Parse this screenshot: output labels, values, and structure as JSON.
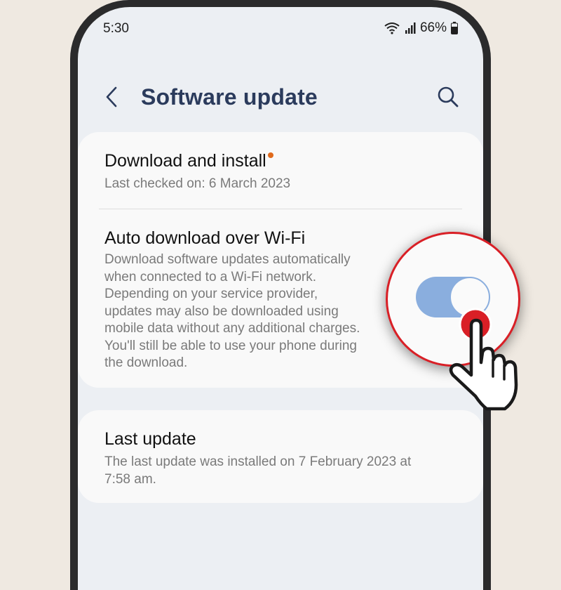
{
  "status_bar": {
    "time": "5:30",
    "battery": "66%"
  },
  "header": {
    "title": "Software update",
    "icons": {
      "back": "back-arrow-icon",
      "search": "search-icon"
    }
  },
  "items": [
    {
      "title": "Download and install",
      "subtitle": "Last checked on: 6 March 2023",
      "badge": "new-dot"
    },
    {
      "title": "Auto download over Wi-Fi",
      "description_lines": [
        "Download software updates automatically",
        "when connected to a Wi-Fi network.",
        "Depending on your service provider,",
        "updates may also be downloaded using",
        "mobile data without any additional charges.",
        "You'll still be able to use your phone during",
        "the download."
      ],
      "toggle_state": "off"
    },
    {
      "title": "Last update",
      "description_lines": [
        "The last update was installed on 7 February 2023 at",
        "7:58 am."
      ]
    }
  ],
  "colors": {
    "title": "#2b3b5c",
    "toggle": "#8aaede",
    "highlight_ring": "#d91f26",
    "badge": "#e06a1c"
  }
}
